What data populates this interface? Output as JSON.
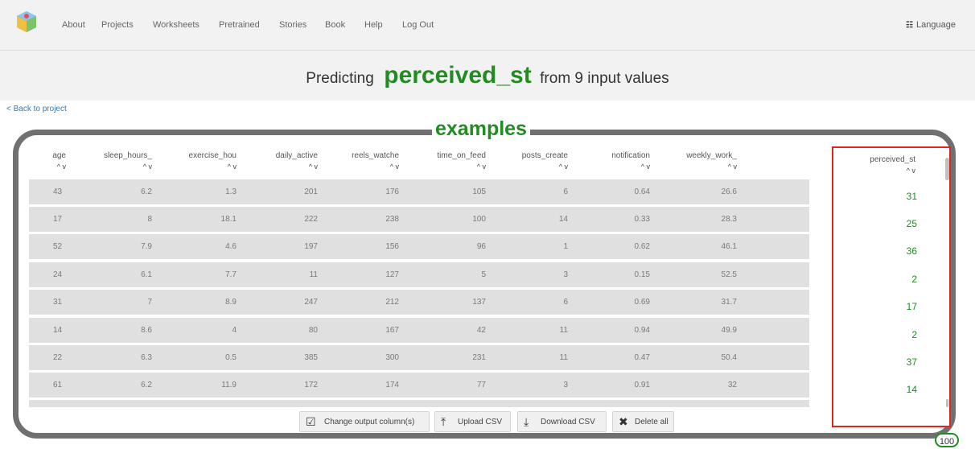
{
  "nav": {
    "items": [
      "About",
      "Projects",
      "Worksheets",
      "Pretrained",
      "Stories",
      "Book",
      "Help",
      "Log Out"
    ],
    "language": "Language",
    "logo_icon": "cube-logo-icon",
    "language_icon": "language-icon"
  },
  "heading": {
    "prefix": "Predicting",
    "target": "perceived_st",
    "suffix": "from 9 input values"
  },
  "back_link": "< Back to project",
  "examples": {
    "label": "examples",
    "columns": [
      "age",
      "sleep_hours_",
      "exercise_hou",
      "daily_active",
      "reels_watche",
      "time_on_feed",
      "posts_create",
      "notification",
      "weekly_work_"
    ],
    "output_column": "perceived_st",
    "sort_arrows": "^ v",
    "rows": [
      [
        "43",
        "6.2",
        "1.3",
        "201",
        "176",
        "105",
        "6",
        "0.64",
        "26.6"
      ],
      [
        "17",
        "8",
        "18.1",
        "222",
        "238",
        "100",
        "14",
        "0.33",
        "28.3"
      ],
      [
        "52",
        "7.9",
        "4.6",
        "197",
        "156",
        "96",
        "1",
        "0.62",
        "46.1"
      ],
      [
        "24",
        "6.1",
        "7.7",
        "11",
        "127",
        "5",
        "3",
        "0.15",
        "52.5"
      ],
      [
        "31",
        "7",
        "8.9",
        "247",
        "212",
        "137",
        "6",
        "0.69",
        "31.7"
      ],
      [
        "14",
        "8.6",
        "4",
        "80",
        "167",
        "42",
        "11",
        "0.94",
        "49.9"
      ],
      [
        "22",
        "6.3",
        "0.5",
        "385",
        "300",
        "231",
        "11",
        "0.47",
        "50.4"
      ],
      [
        "61",
        "6.2",
        "11.9",
        "172",
        "174",
        "77",
        "3",
        "0.91",
        "32"
      ]
    ],
    "output_values": [
      "31",
      "25",
      "36",
      "2",
      "17",
      "2",
      "37",
      "14"
    ],
    "count": "100"
  },
  "buttons": {
    "change_output": "Change output column(s)",
    "upload": "Upload CSV",
    "download": "Download CSV",
    "delete": "Delete all"
  },
  "colors": {
    "accent_green": "#228b22",
    "highlight_red": "#e02424",
    "frame_gray": "#707070"
  }
}
